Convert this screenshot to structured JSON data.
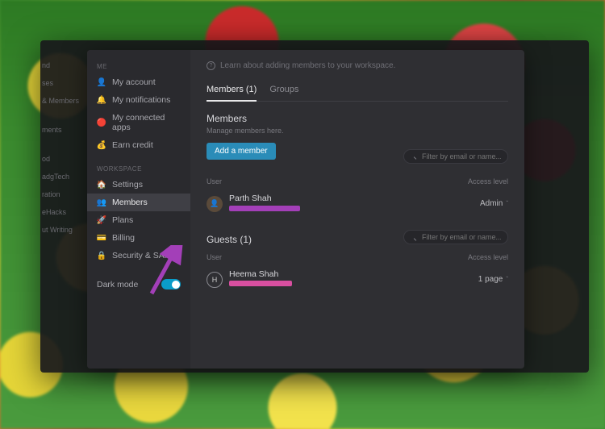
{
  "left_menu": {
    "items": [
      "nd",
      "ses",
      "& Members",
      "",
      "ments",
      "",
      "od",
      "adgTech",
      "ration",
      "eHacks",
      "ut Writing"
    ]
  },
  "sidebar": {
    "me_label": "ME",
    "workspace_label": "WORKSPACE",
    "items_me": [
      {
        "icon": "👤",
        "label": "My account"
      },
      {
        "icon": "🔔",
        "label": "My notifications"
      },
      {
        "icon": "🔴",
        "label": "My connected apps"
      },
      {
        "icon": "💰",
        "label": "Earn credit"
      }
    ],
    "items_ws": [
      {
        "icon": "🏠",
        "label": "Settings"
      },
      {
        "icon": "👥",
        "label": "Members"
      },
      {
        "icon": "🚀",
        "label": "Plans"
      },
      {
        "icon": "💳",
        "label": "Billing"
      },
      {
        "icon": "🔒",
        "label": "Security & SAML"
      }
    ],
    "dark_mode_label": "Dark mode"
  },
  "main": {
    "banner": "Learn about adding members to your workspace.",
    "tabs": [
      {
        "label": "Members (1)"
      },
      {
        "label": "Groups"
      }
    ],
    "members_heading": "Members",
    "members_sub": "Manage members here.",
    "add_member_btn": "Add a member",
    "filter_placeholder": "Filter by email or name...",
    "col_user": "User",
    "col_access": "Access level",
    "member": {
      "name": "Parth Shah",
      "access": "Admin"
    },
    "guests_heading": "Guests (1)",
    "guest": {
      "name": "Heema Shah",
      "initial": "H",
      "access": "1 page"
    }
  },
  "colors": {
    "accent": "#2a8cb8",
    "toggle": "#0a9cc9",
    "redact_purple": "#a33fb8",
    "redact_pink": "#d84fa0",
    "arrow": "#a33fb8"
  }
}
